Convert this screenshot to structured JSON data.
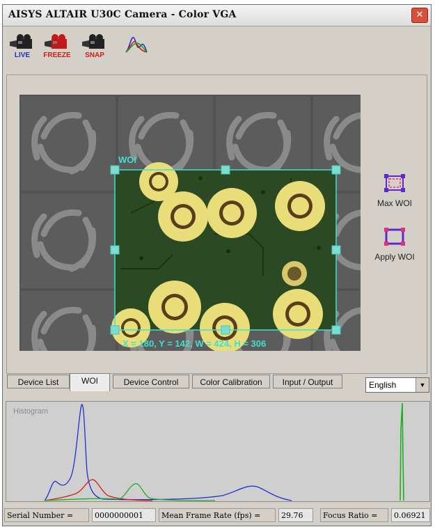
{
  "window": {
    "title": "AISYS ALTAIR U30C Camera - Color VGA",
    "close_glyph": "✕"
  },
  "toolbar": {
    "buttons": [
      {
        "name": "live",
        "label": "LIVE",
        "color": "#1f2fbf"
      },
      {
        "name": "freeze",
        "label": "FREEZE",
        "color": "#d11a1a"
      },
      {
        "name": "snap",
        "label": "SNAP",
        "color": "#d11a1a"
      },
      {
        "name": "histogram",
        "label": "",
        "icon": "histogram-icon"
      }
    ]
  },
  "viewer": {
    "woi_label": "WOI",
    "woi_readout": "X = 180, Y = 142, W = 424, H = 306",
    "accent": "#40e0d0"
  },
  "woi_buttons": {
    "max_label": "Max WOI",
    "apply_label": "Apply WOI"
  },
  "tabs": [
    "Device List",
    "WOI",
    "Device Control",
    "Color Calibration",
    "Input / Output"
  ],
  "active_tab": "WOI",
  "language": {
    "selected": "English"
  },
  "histogram": {
    "title": "Histogram"
  },
  "status": {
    "serial_label": "Serial Number =",
    "serial_value": "0000000001",
    "fps_label": "Mean Frame Rate (fps) =",
    "fps_value": "29.76",
    "focus_label": "Focus Ratio =",
    "focus_value": "0.06921"
  }
}
